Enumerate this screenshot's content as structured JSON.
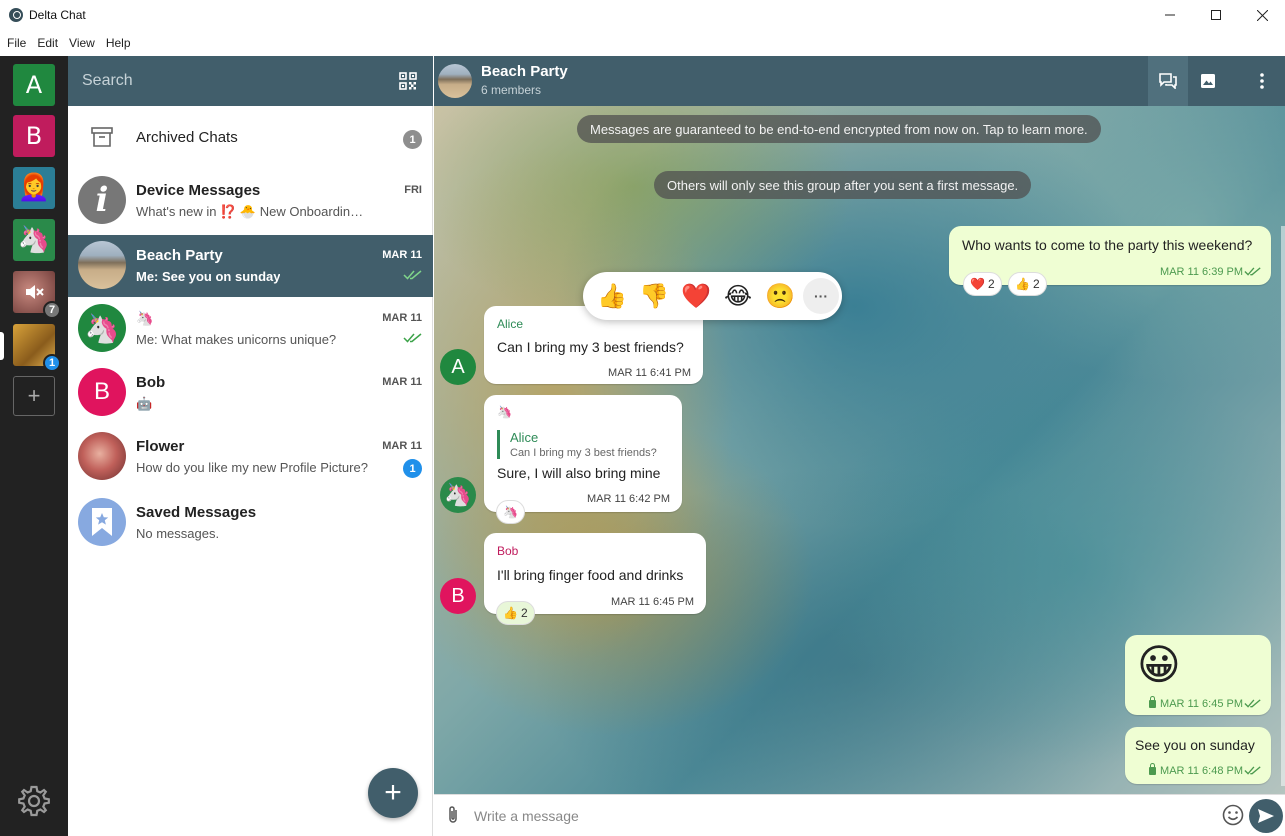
{
  "window": {
    "title": "Delta Chat",
    "minimize": "—",
    "maximize": "☐",
    "close": "✕"
  },
  "menu": [
    "File",
    "Edit",
    "View",
    "Help"
  ],
  "accounts": [
    {
      "letter": "A",
      "color": "#20883f"
    },
    {
      "letter": "B",
      "color": "#c01c5d"
    },
    {
      "letter": "",
      "color": "#2b7e96",
      "emoji": "👩‍🦰"
    },
    {
      "letter": "",
      "color": "#2a8a4a",
      "emoji": "🦄"
    },
    {
      "letter": "",
      "color": "#8a5a55",
      "badge": "7",
      "muted": true
    },
    {
      "letter": "",
      "color": "#b0852a",
      "badge": "1"
    }
  ],
  "add_account_label": "+",
  "search": {
    "placeholder": "Search"
  },
  "chats": [
    {
      "name": "Archived Chats",
      "badge": "1"
    },
    {
      "name": "Device Messages",
      "preview": "What's new in ⁉️ 🐣 New Onboarding: …",
      "date": "FRI",
      "avatar_letter": "i"
    },
    {
      "name": "Beach Party",
      "preview": "Me: See you on sunday",
      "date": "MAR 11",
      "selected": true
    },
    {
      "name": "🦄",
      "preview": "Me: What makes unicorns unique?",
      "date": "MAR 11",
      "avatar_emoji": "🦄"
    },
    {
      "name": "Bob",
      "preview": "🤖",
      "date": "MAR 11",
      "avatar_letter": "B"
    },
    {
      "name": "Flower",
      "preview": "How do you like my new Profile Picture?",
      "date": "MAR 11",
      "badge": "1"
    },
    {
      "name": "Saved Messages",
      "preview": "No messages."
    }
  ],
  "fab_label": "+",
  "chat": {
    "title": "Beach Party",
    "subtitle": "6 members",
    "system_messages": [
      "Messages are guaranteed to be end-to-end encrypted from now on. Tap to learn more.",
      "Others will only see this group after you sent a first message."
    ],
    "reaction_picker": [
      "👍",
      "👎",
      "❤️",
      "😂",
      "🙁"
    ],
    "more_label": "···",
    "messages": [
      {
        "direction": "out",
        "text": "Who wants to come to the party this weekend?",
        "time": "MAR 11 6:39 PM",
        "reactions": [
          {
            "emoji": "❤️",
            "count": "2"
          },
          {
            "emoji": "👍",
            "count": "2"
          }
        ]
      },
      {
        "direction": "in",
        "author": "Alice",
        "author_color": "#2e8b57",
        "avatar_letter": "A",
        "avatar_color": "#20883f",
        "text": "Can I bring my 3 best friends?",
        "time": "MAR 11 6:41 PM"
      },
      {
        "direction": "in",
        "author": "🦄",
        "avatar_emoji": "🦄",
        "avatar_color": "#2a8a4a",
        "quote_author": "Alice",
        "quote_text": "Can I bring my 3 best friends?",
        "text": "Sure, I will also bring mine",
        "time": "MAR 11 6:42 PM",
        "reactions": [
          {
            "emoji": "🦄",
            "count": ""
          }
        ]
      },
      {
        "direction": "in",
        "author": "Bob",
        "author_color": "#c01c5d",
        "avatar_letter": "B",
        "avatar_color": "#e0145e",
        "text": "I'll bring finger food and drinks",
        "time": "MAR 11 6:45 PM",
        "reactions": [
          {
            "emoji": "👍",
            "count": "2"
          }
        ]
      },
      {
        "direction": "out",
        "emoji_only": "😀",
        "time": "MAR 11 6:45 PM"
      },
      {
        "direction": "out",
        "text": "See you on sunday",
        "time": "MAR 11 6:48 PM"
      }
    ]
  },
  "composer": {
    "placeholder": "Write a message"
  },
  "colors": {
    "header": "#415e6b",
    "rail": "#222222",
    "outgoing": "#effed3",
    "accent_blue": "#2090ea"
  }
}
